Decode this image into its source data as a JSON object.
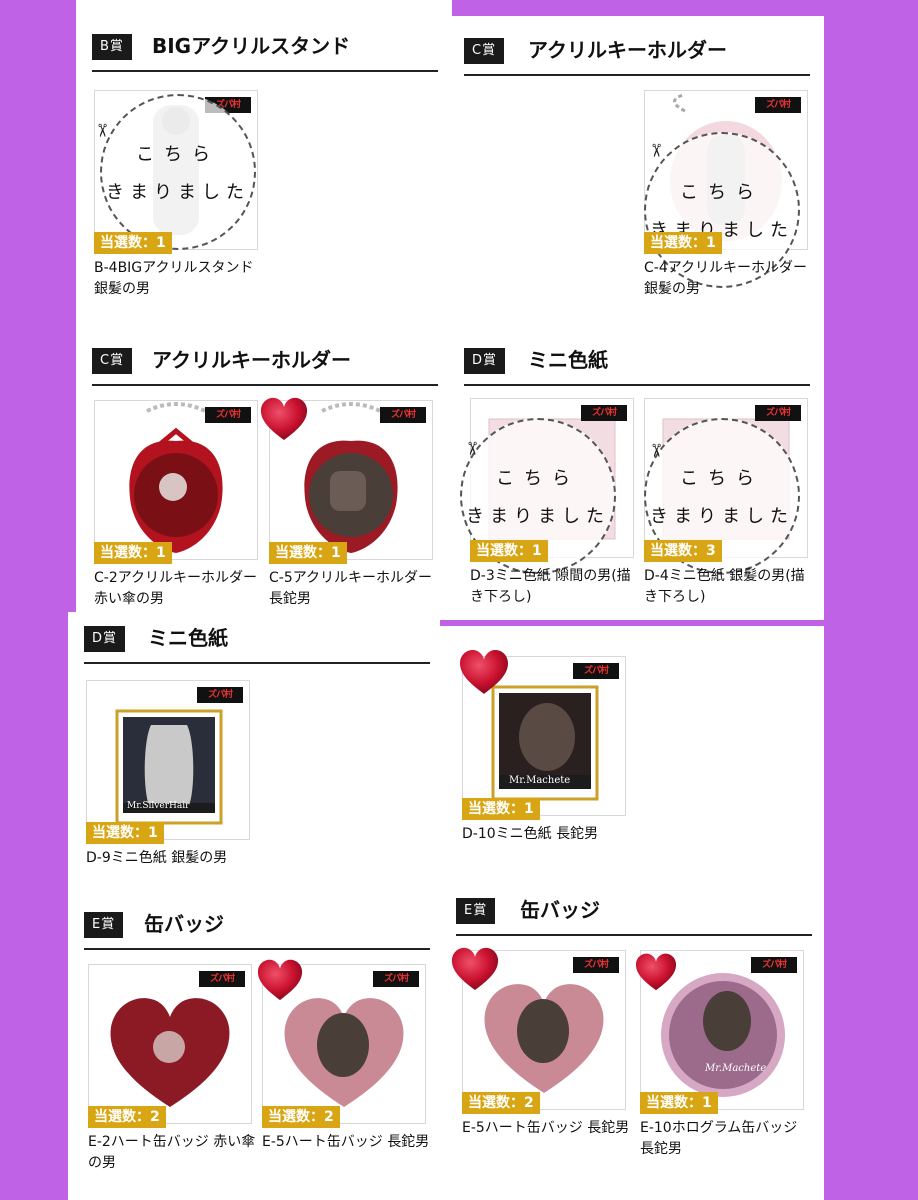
{
  "logo_text": "ズパ村",
  "stamp": {
    "line1": "こちら",
    "line2": "きまりました",
    "scissors": "✂"
  },
  "sections": {
    "b": {
      "tag": "B賞",
      "title": "BIGアクリルスタンド",
      "items": [
        {
          "win": "当選数：1",
          "caption": "B-4BIGアクリルスタンド 銀髪の男"
        }
      ]
    },
    "c1": {
      "tag": "C賞",
      "title": "アクリルキーホルダー",
      "items": [
        {
          "win": "当選数：1",
          "caption": "C-4アクリルキーホルダー 銀髪の男"
        }
      ]
    },
    "c2": {
      "tag": "C賞",
      "title": "アクリルキーホルダー",
      "items": [
        {
          "win": "当選数：1",
          "caption": "C-2アクリルキーホルダー 赤い傘の男"
        },
        {
          "win": "当選数：1",
          "caption": "C-5アクリルキーホルダー 長鉈男"
        }
      ]
    },
    "d1": {
      "tag": "D賞",
      "title": "ミニ色紙",
      "items": [
        {
          "win": "当選数：1",
          "caption": "D-3ミニ色紙 隙間の男(描き下ろし)"
        },
        {
          "win": "当選数：3",
          "caption": "D-4ミニ色紙 銀髪の男(描き下ろし)"
        }
      ]
    },
    "d2": {
      "tag": "D賞",
      "title": "ミニ色紙",
      "items": [
        {
          "win": "当選数：1",
          "caption": "D-9ミニ色紙 銀髪の男",
          "plate": "Mr.SilverHair"
        }
      ]
    },
    "d3": {
      "items": [
        {
          "win": "当選数：1",
          "caption": "D-10ミニ色紙 長鉈男",
          "plate": "Mr.Machete"
        }
      ]
    },
    "e1": {
      "tag": "E賞",
      "title": "缶バッジ",
      "items": [
        {
          "win": "当選数：2",
          "caption": "E-2ハート缶バッジ 赤い傘の男"
        },
        {
          "win": "当選数：2",
          "caption": "E-5ハート缶バッジ 長鉈男"
        }
      ]
    },
    "e2": {
      "tag": "E賞",
      "title": "缶バッジ",
      "items": [
        {
          "win": "当選数：2",
          "caption": "E-5ハート缶バッジ 長鉈男"
        },
        {
          "win": "当選数：1",
          "caption": "E-10ホログラム缶バッジ 長鉈男",
          "plate": "Mr.Machete"
        }
      ]
    }
  },
  "colors": {
    "background": "#c062e6",
    "win_badge": "#d8a614",
    "heart": "#c8102e",
    "header_tag": "#1a1a1a"
  }
}
